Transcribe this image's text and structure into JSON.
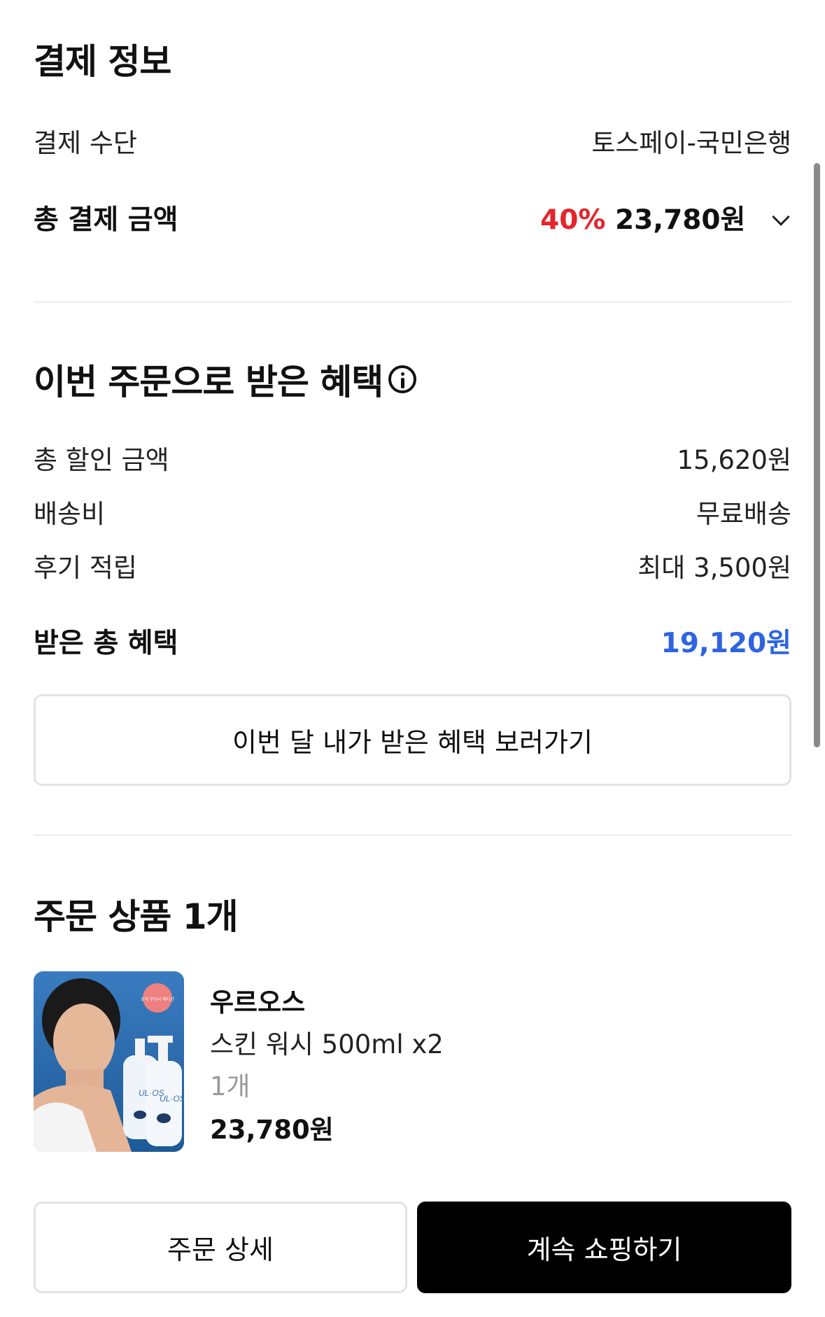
{
  "payment": {
    "title": "결제 정보",
    "method_label": "결제 수단",
    "method_value": "토스페이-국민은행",
    "total_label": "총 결제 금액",
    "total_discount": "40%",
    "total_value": "23,780원"
  },
  "benefits": {
    "title": "이번 주문으로 받은 혜택",
    "discount_label": "총 할인 금액",
    "discount_value": "15,620원",
    "shipping_label": "배송비",
    "shipping_value": "무료배송",
    "review_label": "후기 적립",
    "review_value": "최대 3,500원",
    "total_label": "받은 총 혜택",
    "total_value": "19,120원",
    "view_button": "이번 달 내가 받은 혜택 보러가기"
  },
  "order": {
    "title": "주문 상품 1개",
    "product": {
      "brand": "우르오스",
      "name": "스킨 워시 500ml x2",
      "quantity": "1개",
      "price": "23,780원",
      "image_badge": "오직 무신사 에디션",
      "bottle_brand": "UL·OS"
    }
  },
  "actions": {
    "detail_button": "주문 상세",
    "continue_button": "계속 쇼핑하기"
  },
  "colors": {
    "discount_red": "#e5242b",
    "benefit_blue": "#2e64e0",
    "primary_black": "#000000"
  }
}
